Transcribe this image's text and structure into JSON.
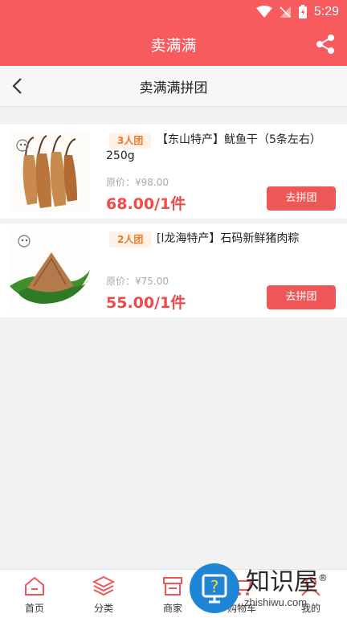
{
  "status": {
    "time": "5:29"
  },
  "app": {
    "title": "卖满满"
  },
  "subheader": {
    "title": "卖满满拼团"
  },
  "products": [
    {
      "badge": "3人团",
      "name_line1": "【东山特产】鱿鱼干（5条左右）",
      "name_line2": "250g",
      "original_price": "原价：¥98.00",
      "price": "68.00/1件",
      "button": "去拼团"
    },
    {
      "badge": "2人团",
      "name_line1": "[l龙海特产】石码新鲜猪肉粽",
      "original_price": "原价：¥75.00",
      "price": "55.00/1件",
      "button": "去拼团"
    }
  ],
  "tabs": [
    {
      "label": "首页",
      "icon": "home-icon"
    },
    {
      "label": "分类",
      "icon": "layers-icon"
    },
    {
      "label": "商家",
      "icon": "store-icon"
    },
    {
      "label": "购物车",
      "icon": "cart-icon"
    },
    {
      "label": "我的",
      "icon": "user-icon"
    }
  ],
  "watermark": {
    "brand": "知识屋",
    "reg": "®",
    "url": "zhishiwu.com"
  },
  "colors": {
    "primary": "#f75b5d",
    "price": "#ef4a47",
    "badge_text": "#f07a22",
    "button": "#ef5757"
  }
}
